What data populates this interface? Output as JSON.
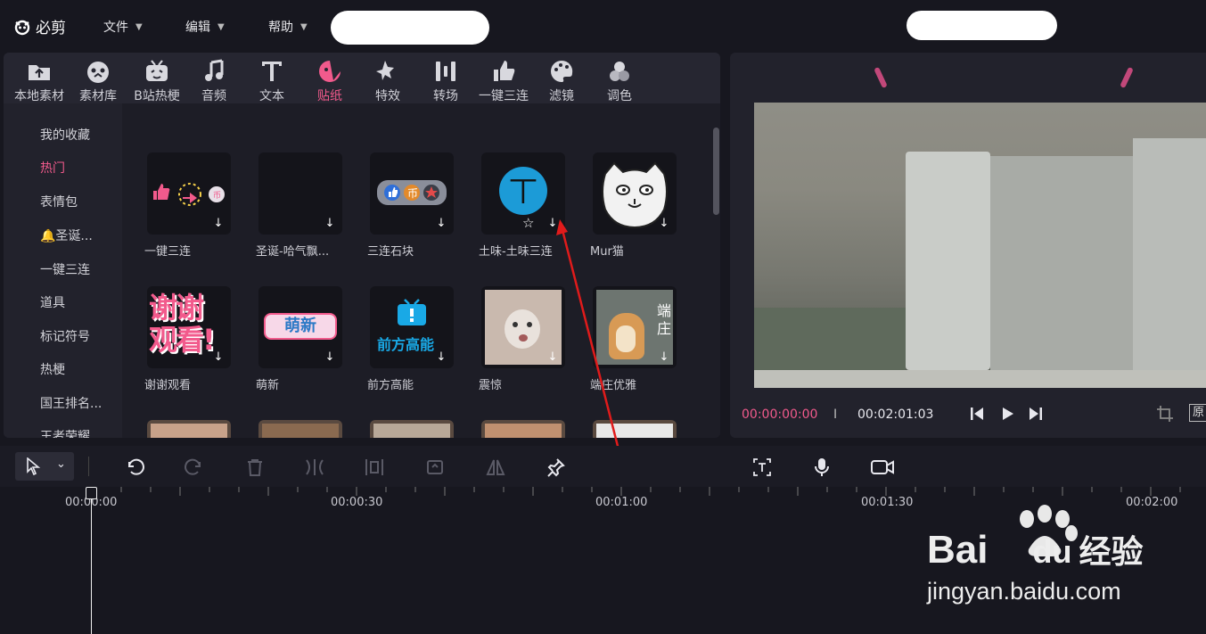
{
  "app": {
    "name": "必剪"
  },
  "menu": [
    {
      "label": "文件"
    },
    {
      "label": "编辑"
    },
    {
      "label": "帮助"
    }
  ],
  "tabs": [
    {
      "label": "本地素材",
      "icon": "upload-folder-icon"
    },
    {
      "label": "素材库",
      "icon": "material-library-icon"
    },
    {
      "label": "B站热梗",
      "icon": "bilibili-tv-icon"
    },
    {
      "label": "音频",
      "icon": "music-note-icon"
    },
    {
      "label": "文本",
      "icon": "text-t-icon"
    },
    {
      "label": "贴纸",
      "icon": "sticker-icon",
      "active": true
    },
    {
      "label": "特效",
      "icon": "effects-star-icon"
    },
    {
      "label": "转场",
      "icon": "transition-icon"
    },
    {
      "label": "一键三连",
      "icon": "thumbs-up-icon"
    },
    {
      "label": "滤镜",
      "icon": "palette-icon"
    },
    {
      "label": "调色",
      "icon": "color-adjust-icon"
    }
  ],
  "sidebar": [
    {
      "label": "我的收藏"
    },
    {
      "label": "热门",
      "active": true
    },
    {
      "label": "表情包"
    },
    {
      "label": "🔔圣诞..."
    },
    {
      "label": "一键三连"
    },
    {
      "label": "道具"
    },
    {
      "label": "标记符号"
    },
    {
      "label": "热梗"
    },
    {
      "label": "国王排名..."
    },
    {
      "label": "王者荣耀"
    }
  ],
  "stickers_row1": [
    {
      "label": "一键三连"
    },
    {
      "label": "圣诞-哈气飘..."
    },
    {
      "label": "三连石块"
    },
    {
      "label": "土味-土味三连"
    },
    {
      "label": "Mur猫"
    }
  ],
  "stickers_row2": [
    {
      "label": "谢谢观看"
    },
    {
      "label": "萌新"
    },
    {
      "label": "前方高能"
    },
    {
      "label": "震惊"
    },
    {
      "label": "端庄优雅"
    }
  ],
  "sticker_text": {
    "xiexie_line1": "谢谢",
    "xiexie_line2": "观看!",
    "mengxin": "萌新",
    "qianfang": "前方高能",
    "duanzhuang_1": "端",
    "duanzhuang_2": "庄",
    "tuwei_char": "丅"
  },
  "preview": {
    "current_time": "00:00:00:00",
    "separator": "I",
    "total_time": "00:02:01:03",
    "ratio_label": "原"
  },
  "timeline": {
    "labels": [
      "00:00:00",
      "00:00:30",
      "00:01:00",
      "00:01:30",
      "00:02:00"
    ]
  },
  "watermark": {
    "brand": "Bai",
    "brand2": "du",
    "brand_cn": "经验",
    "url": "jingyan.baidu.com"
  },
  "colors": {
    "accent": "#f25a8c",
    "background": "#17171f",
    "panel": "#22222c"
  }
}
